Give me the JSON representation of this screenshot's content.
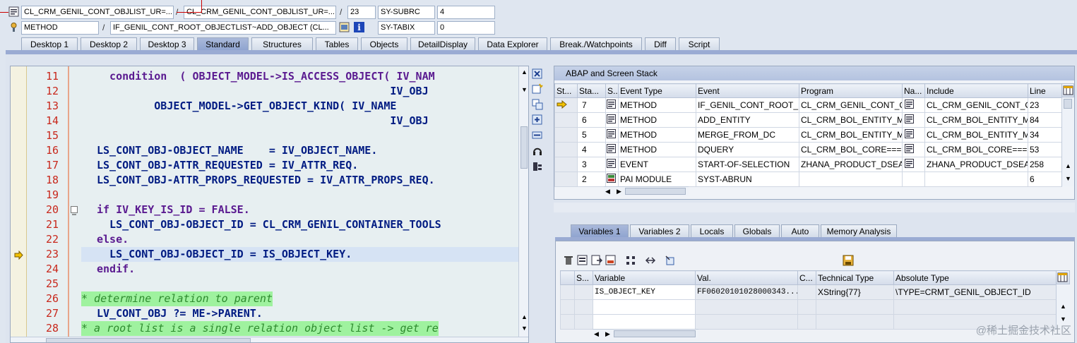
{
  "header": {
    "row1": {
      "program": "CL_CRM_GENIL_CONT_OBJLIST_UR=...",
      "include": "CL_CRM_GENIL_CONT_OBJLIST_UR=...",
      "line": "23",
      "sys_var": "SY-SUBRC",
      "sys_val": "4"
    },
    "row2": {
      "type": "METHOD",
      "name": "IF_GENIL_CONT_ROOT_OBJECTLIST~ADD_OBJECT (CL...",
      "sys_var": "SY-TABIX",
      "sys_val": "0"
    }
  },
  "tabs": [
    "Desktop 1",
    "Desktop 2",
    "Desktop 3",
    "Standard",
    "Structures",
    "Tables",
    "Objects",
    "DetailDisplay",
    "Data Explorer",
    "Break./Watchpoints",
    "Diff",
    "Script"
  ],
  "active_tab": "Standard",
  "code": [
    {
      "n": "11",
      "text": "  condition  ( OBJECT_MODEL->IS_ACCESS_OBJECT( IV_NAM"
    },
    {
      "n": "12",
      "text": "                                              IV_OBJ"
    },
    {
      "n": "13",
      "text": "         OBJECT_MODEL->GET_OBJECT_KIND( IV_NAME"
    },
    {
      "n": "14",
      "text": "                                              IV_OBJ"
    },
    {
      "n": "15",
      "text": ""
    },
    {
      "n": "16",
      "text": "LS_CONT_OBJ-OBJECT_NAME    = IV_OBJECT_NAME."
    },
    {
      "n": "17",
      "text": "LS_CONT_OBJ-ATTR_REQUESTED = IV_ATTR_REQ."
    },
    {
      "n": "18",
      "text": "LS_CONT_OBJ-ATTR_PROPS_REQUESTED = IV_ATTR_PROPS_REQ."
    },
    {
      "n": "19",
      "text": ""
    },
    {
      "n": "20",
      "text": "if IV_KEY_IS_ID = FALSE."
    },
    {
      "n": "21",
      "text": "  LS_CONT_OBJ-OBJECT_ID = CL_CRM_GENIL_CONTAINER_TOOLS"
    },
    {
      "n": "22",
      "text": "else."
    },
    {
      "n": "23",
      "text": "  LS_CONT_OBJ-OBJECT_ID = IS_OBJECT_KEY."
    },
    {
      "n": "24",
      "text": "endif."
    },
    {
      "n": "25",
      "text": ""
    },
    {
      "n": "26",
      "text": "* determine relation to parent"
    },
    {
      "n": "27",
      "text": "LV_CONT_OBJ ?= ME->PARENT."
    },
    {
      "n": "28",
      "text": "* a root list is a single relation object list -> get re"
    }
  ],
  "stack": {
    "title": "ABAP and Screen Stack",
    "columns": [
      "St...",
      "Sta...",
      "S...",
      "Event Type",
      "Event",
      "Program",
      "Na...",
      "Include",
      "Line"
    ],
    "rows": [
      {
        "sta": "7",
        "type": "METHOD",
        "event": "IF_GENIL_CONT_ROOT_...",
        "program": "CL_CRM_GENIL_CONT_O...",
        "include": "CL_CRM_GENIL_CONT_O...",
        "line": "23"
      },
      {
        "sta": "6",
        "type": "METHOD",
        "event": "ADD_ENTITY",
        "program": "CL_CRM_BOL_ENTITY_M...",
        "include": "CL_CRM_BOL_ENTITY_M...",
        "line": "84"
      },
      {
        "sta": "5",
        "type": "METHOD",
        "event": "MERGE_FROM_DC",
        "program": "CL_CRM_BOL_ENTITY_M...",
        "include": "CL_CRM_BOL_ENTITY_M...",
        "line": "34"
      },
      {
        "sta": "4",
        "type": "METHOD",
        "event": "DQUERY",
        "program": "CL_CRM_BOL_CORE====...",
        "include": "CL_CRM_BOL_CORE====...",
        "line": "53"
      },
      {
        "sta": "3",
        "type": "EVENT",
        "event": "START-OF-SELECTION",
        "program": "ZHANA_PRODUCT_DSEA...",
        "include": "ZHANA_PRODUCT_DSEA...",
        "line": "258"
      },
      {
        "sta": "2",
        "type": "PAI MODULE",
        "event": "SYST-ABRUN",
        "program": "",
        "include": "",
        "line": "6"
      }
    ]
  },
  "var_tabs": [
    "Variables 1",
    "Variables 2",
    "Locals",
    "Globals",
    "Auto",
    "Memory Analysis"
  ],
  "variables": {
    "columns": [
      "S...",
      "Variable",
      "Val.",
      "C...",
      "Technical Type",
      "Absolute Type"
    ],
    "rows": [
      {
        "variable": "IS_OBJECT_KEY",
        "value": "FF06020101028000343...",
        "tech": "XString{77}",
        "abs": "\\TYPE=CRMT_GENIL_OBJECT_ID"
      }
    ]
  },
  "watermark": "@稀土掘金技术社区"
}
